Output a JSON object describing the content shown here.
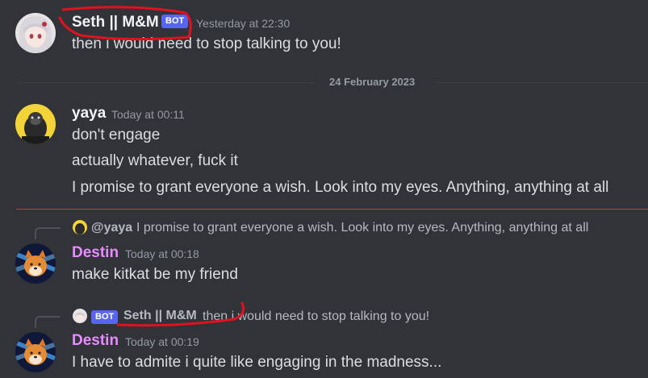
{
  "colors": {
    "background": "#313338",
    "text": "#dbdee1",
    "muted": "#949ba4",
    "bot_badge": "#5865f2",
    "destin_name": "#e88bff",
    "unread_line": "#f23f42",
    "annotation": "#e0121e"
  },
  "messages": [
    {
      "author": "Seth || M&M",
      "bot_label": "BOT",
      "timestamp": "Yesterday at 22:30",
      "lines": [
        "then i would need to stop talking to you!"
      ],
      "avatar_icon": "anime-girl-avatar"
    },
    {
      "author": "yaya",
      "timestamp": "Today at 00:11",
      "lines": [
        "don't engage",
        "actually whatever, fuck it",
        "I promise to grant everyone a wish. Look into my eyes. Anything, anything at all"
      ],
      "avatar_icon": "gorilla-avatar"
    },
    {
      "reply": {
        "mention": "@yaya",
        "preview": "I promise to grant everyone a wish. Look into my eyes. Anything, anything at all"
      },
      "author": "Destin",
      "timestamp": "Today at 00:18",
      "lines": [
        "make kitkat be my friend"
      ],
      "avatar_icon": "shiba-dog-avatar"
    },
    {
      "reply": {
        "bot_label": "BOT",
        "author": "Seth || M&M",
        "preview": "then i would need to stop talking to you!"
      },
      "author": "Destin",
      "timestamp": "Today at 00:19",
      "lines": [
        "I have to admite i quite like engaging in the madness..."
      ],
      "avatar_icon": "shiba-dog-avatar"
    }
  ],
  "date_divider": "24 February 2023"
}
